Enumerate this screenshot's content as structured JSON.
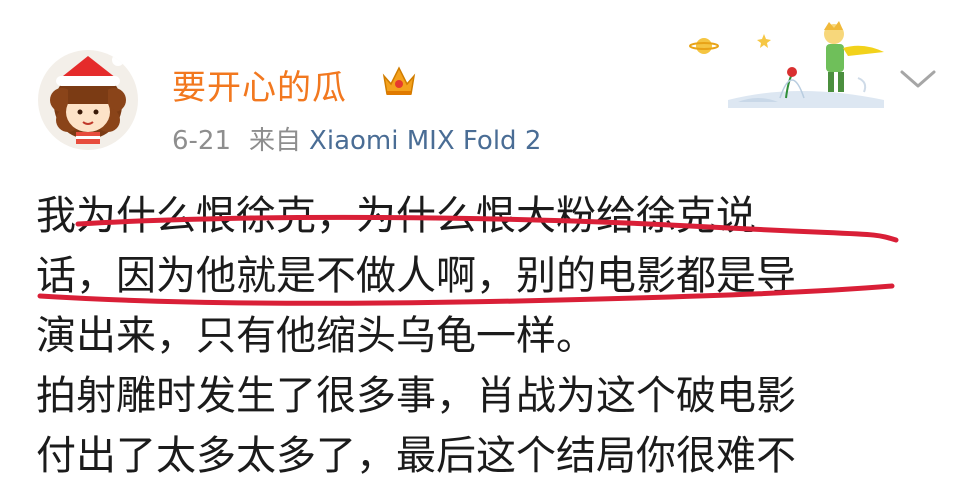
{
  "post": {
    "username": "要开心的瓜",
    "date": "6-21",
    "from_label": "来自",
    "device": "Xiaomi MIX Fold 2",
    "lines": [
      "我为什么恨徐克，为什么恨大粉给徐克说",
      "话，因为他就是不做人啊，别的电影都是导",
      "演出来，只有他缩头乌龟一样。",
      "拍射雕时发生了很多事，肖战为这个破电影",
      "付出了太多太多了，最后这个结局你很难不"
    ]
  },
  "colors": {
    "username": "#f2781f",
    "device_link": "#4a6d95",
    "meta_text": "#8e8e8e",
    "highlight_stroke": "#d91f37"
  },
  "icons": {
    "avatar": "cartoon-girl-avatar",
    "badge": "crown-icon",
    "decoration": "little-prince-decoration",
    "menu": "chevron-down-icon"
  }
}
